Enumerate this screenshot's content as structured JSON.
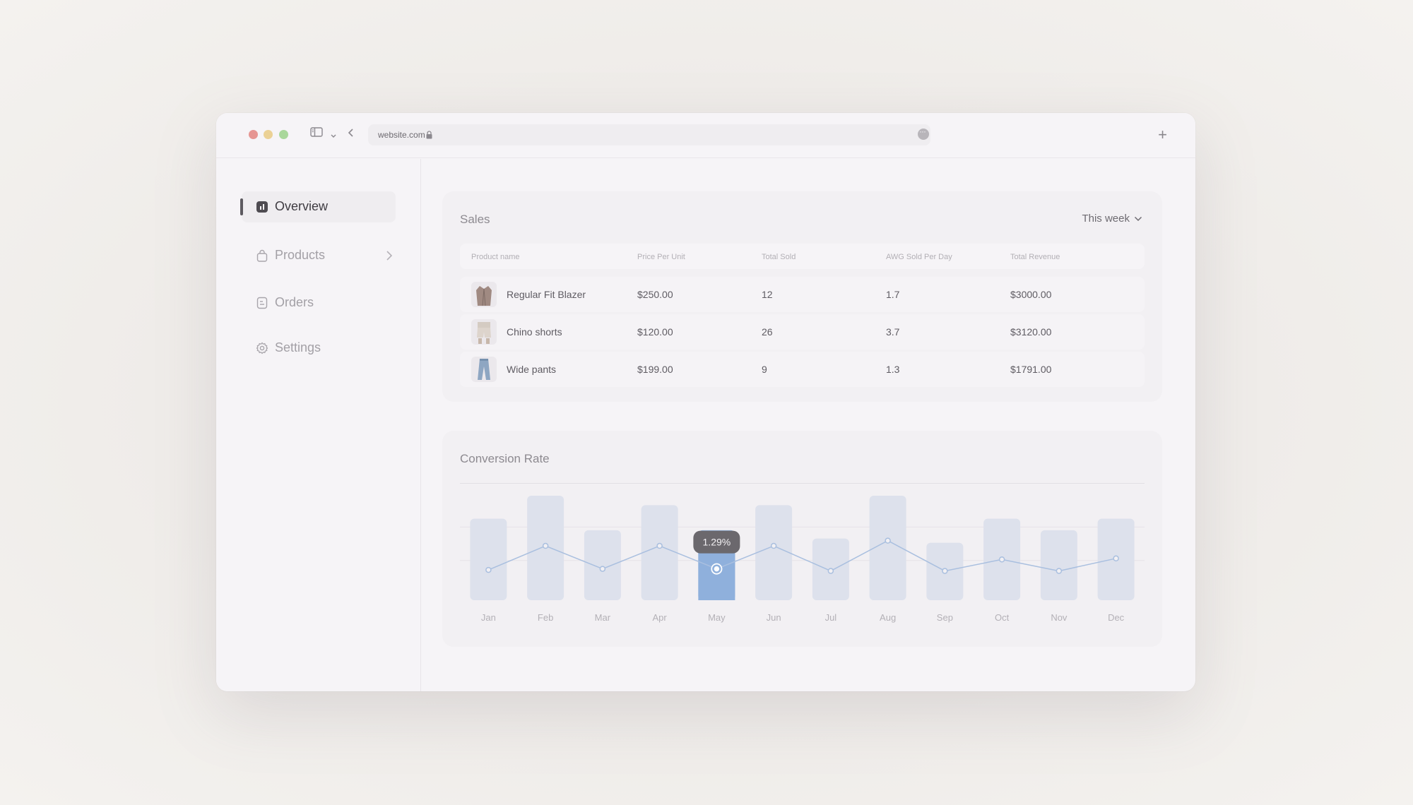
{
  "browser": {
    "url": "website.com"
  },
  "sidebar": {
    "items": [
      {
        "label": "Overview",
        "icon": "chart-icon",
        "active": true
      },
      {
        "label": "Products",
        "icon": "bag-icon",
        "active": false
      },
      {
        "label": "Orders",
        "icon": "document-icon",
        "active": false
      },
      {
        "label": "Settings",
        "icon": "gear-icon",
        "active": false
      }
    ]
  },
  "sales": {
    "title": "Sales",
    "filter_label": "This week",
    "columns": [
      "Product name",
      "Price Per Unit",
      "Total Sold",
      "AWG Sold Per Day",
      "Total Revenue"
    ],
    "rows": [
      {
        "name": "Regular Fit Blazer",
        "price": "$250.00",
        "sold": "12",
        "per_day": "1.7",
        "revenue": "$3000.00"
      },
      {
        "name": "Chino shorts",
        "price": "$120.00",
        "sold": "26",
        "per_day": "3.7",
        "revenue": "$3120.00"
      },
      {
        "name": "Wide pants",
        "price": "$199.00",
        "sold": "9",
        "per_day": "1.3",
        "revenue": "$1791.00"
      }
    ]
  },
  "conversion": {
    "title": "Conversion Rate",
    "tooltip": "1.29%"
  },
  "colors": {
    "bar": "#dde1ec",
    "bar_highlight": "#8fb0dc",
    "line": "#a9bfdf",
    "tooltip_bg": "#6b686d"
  },
  "chart_data": {
    "type": "bar",
    "categories": [
      "Jan",
      "Feb",
      "Mar",
      "Apr",
      "May",
      "Jun",
      "Jul",
      "Aug",
      "Sep",
      "Oct",
      "Nov",
      "Dec"
    ],
    "series": [
      {
        "values": [
          0.78,
          1.0,
          0.67,
          0.91,
          0.67,
          0.91,
          0.59,
          1.0,
          0.55,
          0.78,
          0.67,
          0.78
        ]
      },
      {
        "values": [
          0.29,
          0.52,
          0.3,
          0.52,
          0.3,
          0.52,
          0.28,
          0.57,
          0.28,
          0.39,
          0.28,
          0.4
        ]
      }
    ],
    "highlight_index": 4,
    "tooltip_value": "1.29%",
    "ylim": [
      0,
      1
    ],
    "grid": true
  }
}
